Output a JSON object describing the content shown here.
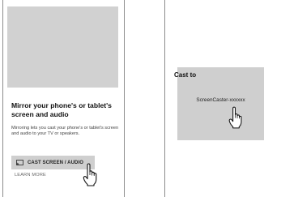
{
  "left_screen": {
    "title": "Mirror your phone's or tablet's screen and audio",
    "description": "Mirroring lets you cast your phone's or tablet's screen and audio to your TV or speakers.",
    "cast_button_label": "CAST SCREEN / AUDIO",
    "cast_button_icon": "cast-icon",
    "learn_more_label": "LEARN MORE",
    "pointer_icon": "hand-pointer-icon"
  },
  "right_screen": {
    "dialog_title": "Cast to",
    "devices": [
      "ScreenCaster-xxxxxx"
    ],
    "pointer_icon": "hand-pointer-icon"
  },
  "colors": {
    "panel_gray": "#cfcfcf",
    "hero_gray": "#d1d1d1",
    "frame_border": "#8c8c8c"
  }
}
